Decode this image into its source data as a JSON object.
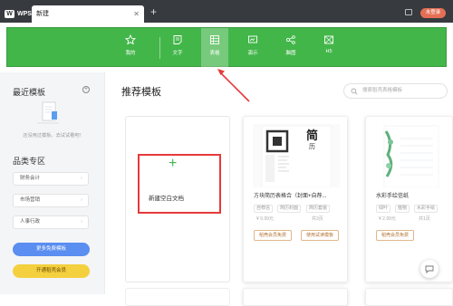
{
  "app": {
    "logo_text": "WPS",
    "tab_title": "新建",
    "login": "未登录"
  },
  "ribbon": {
    "items": [
      {
        "label": "我的",
        "icon": "star-icon"
      },
      {
        "label": "文字",
        "icon": "text-doc-icon"
      },
      {
        "label": "表格",
        "icon": "table-icon",
        "active": true
      },
      {
        "label": "演示",
        "icon": "slide-icon"
      },
      {
        "label": "脑图",
        "icon": "mindmap-icon"
      },
      {
        "label": "H5",
        "icon": "h5-icon"
      }
    ],
    "color": "#43b64a"
  },
  "sidebar": {
    "recent_title": "最近模板",
    "empty_text": "还没用过模板，去试试看吧！",
    "category_title": "品类专区",
    "categories": [
      "财务会计",
      "市场营销",
      "人事行政"
    ],
    "more_free": "更多免费模板",
    "vip": "开通稻壳会员"
  },
  "main": {
    "title": "推荐模板",
    "search_placeholder": "搜索稻壳表格模板",
    "blank_label": "新建空白文档"
  },
  "templates": [
    {
      "name": "方块简历表格合（封面+自荐...",
      "tags": [
        "自荐信",
        "简历封面",
        "简历套装"
      ],
      "price": "¥ 9.99元",
      "pages": "共3页",
      "btn1": "稻壳会员免费",
      "btn2": "使用试读模板",
      "thumb_title": "简",
      "thumb_sub": "历"
    },
    {
      "name": "水彩手绘信纸",
      "tags": [
        "绿叶",
        "植物",
        "水彩手绘"
      ],
      "price": "¥ 2.99元",
      "pages": "共1页",
      "btn1": "稻壳会员免费"
    }
  ],
  "annotation_color": "#e53a3a"
}
